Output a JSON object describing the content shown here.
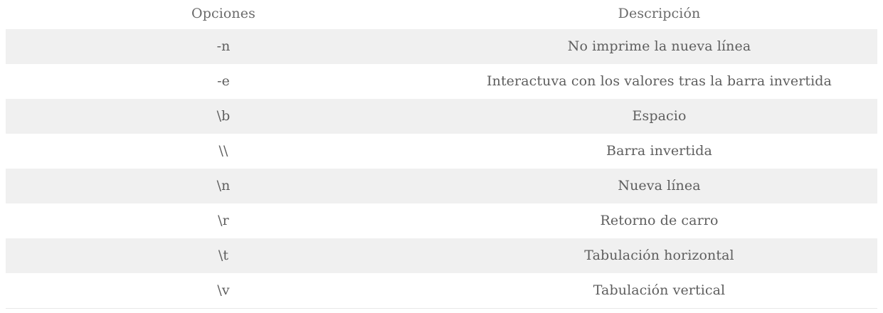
{
  "table": {
    "headers": [
      "Opciones",
      "Descripción"
    ],
    "rows": [
      {
        "option": "-n",
        "description": "No imprime la nueva línea"
      },
      {
        "option": "-e",
        "description": "Interactuva con los valores tras la barra invertida"
      },
      {
        "option": "\\b",
        "description": "Espacio"
      },
      {
        "option": "\\\\",
        "description": "Barra invertida"
      },
      {
        "option": "\\n",
        "description": "Nueva línea"
      },
      {
        "option": "\\r",
        "description": "Retorno de carro"
      },
      {
        "option": "\\t",
        "description": "Tabulación horizontal"
      },
      {
        "option": "\\v",
        "description": "Tabulación vertical"
      }
    ]
  }
}
